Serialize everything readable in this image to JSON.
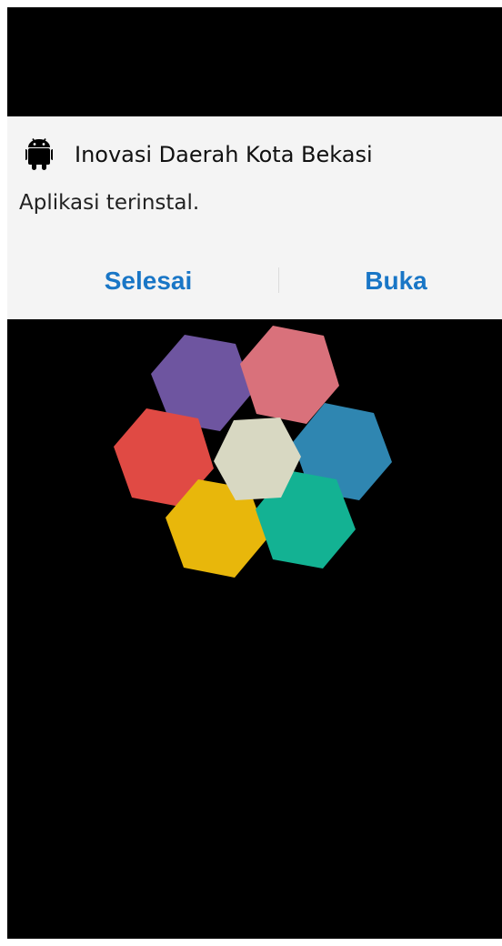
{
  "dialog": {
    "app_name": "Inovasi Daerah Kota Bekasi",
    "message": "Aplikasi terinstal.",
    "done_label": "Selesai",
    "open_label": "Buka",
    "app_icon": "android-icon"
  },
  "colors": {
    "accent": "#1976c6",
    "dialog_bg": "#f4f4f4",
    "screen_bg": "#000000",
    "hex_purple": "#6e55a0",
    "hex_pink": "#d9717b",
    "hex_red": "#e04a44",
    "hex_center": "#d8d8c2",
    "hex_blue": "#2f86b1",
    "hex_yellow": "#e8b70b",
    "hex_green": "#13b293"
  }
}
